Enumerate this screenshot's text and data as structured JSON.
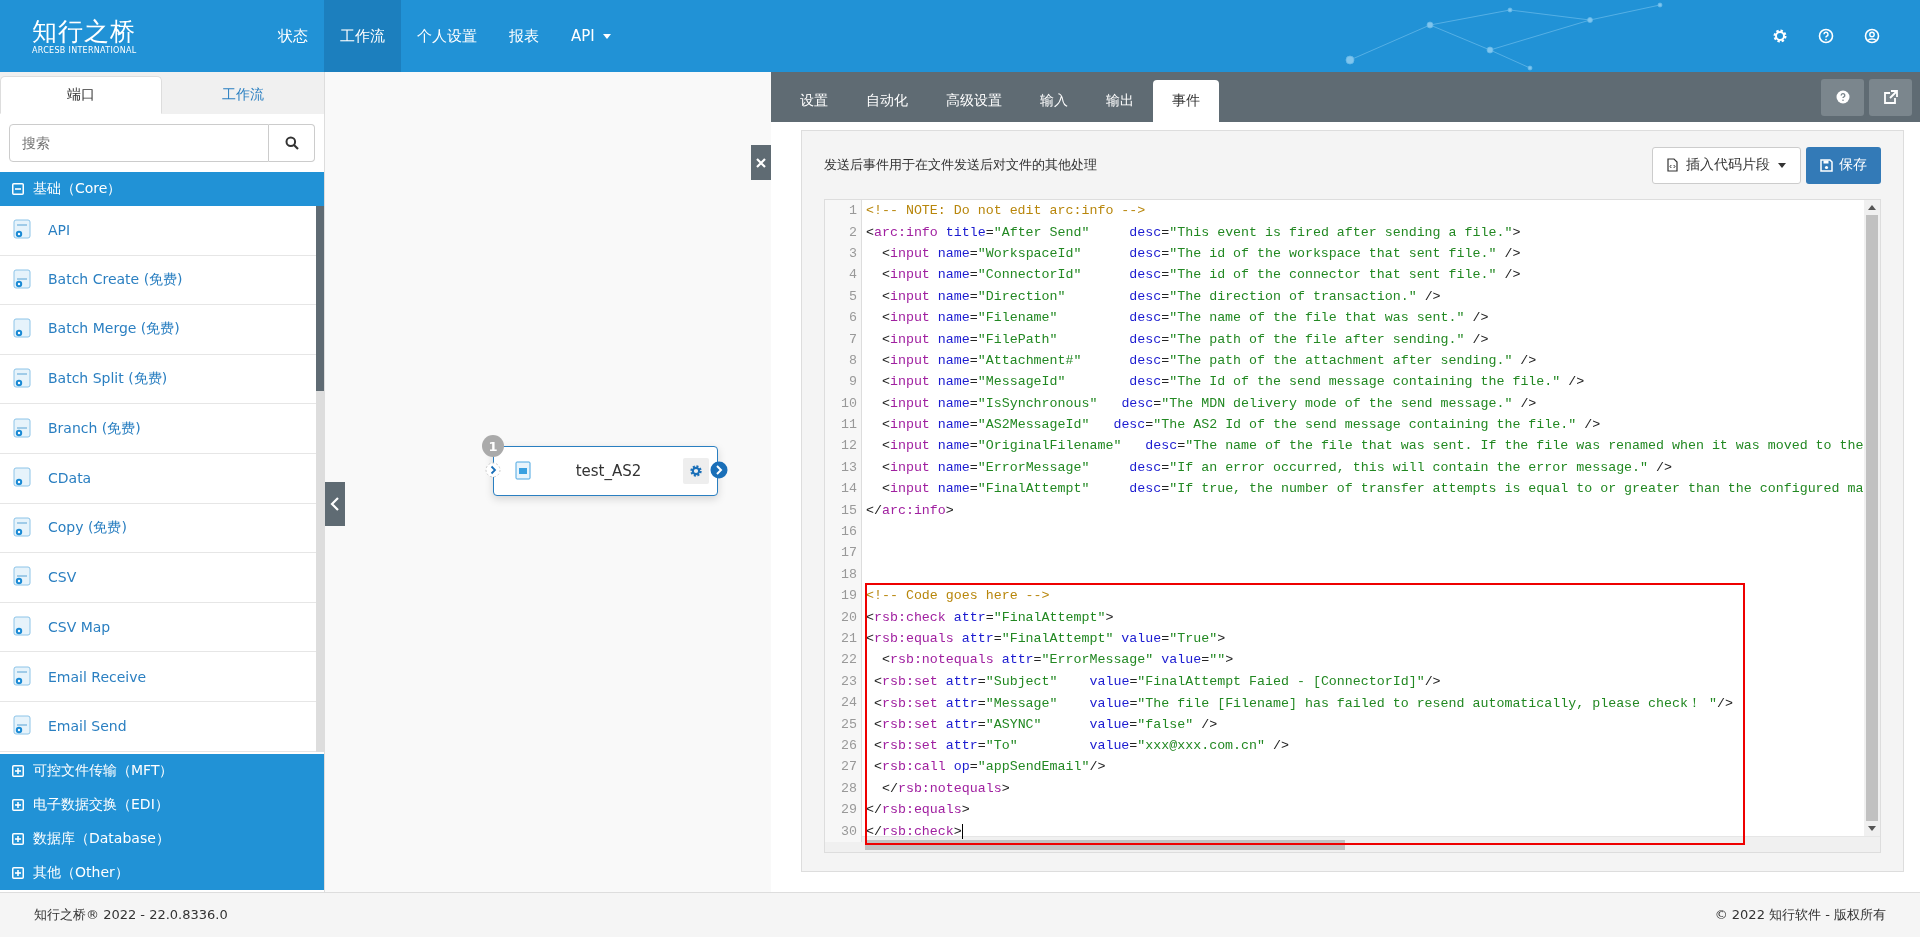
{
  "header": {
    "logo": "知行之桥",
    "logo_subtitle": "ARCESB INTERNATIONAL",
    "nav": [
      {
        "label": "状态",
        "selected": false,
        "has_menu": false
      },
      {
        "label": "工作流",
        "selected": true,
        "has_menu": false
      },
      {
        "label": "个人设置",
        "selected": false,
        "has_menu": false
      },
      {
        "label": "报表",
        "selected": false,
        "has_menu": false
      },
      {
        "label": "API",
        "selected": false,
        "has_menu": true
      }
    ]
  },
  "sidebar": {
    "tabs": [
      {
        "label": "端口",
        "selected": true
      },
      {
        "label": "工作流",
        "selected": false
      }
    ],
    "search": {
      "placeholder": "搜索"
    },
    "categories": [
      {
        "label": "基础（Core）",
        "expanded": true,
        "items": [
          "API",
          "Batch Create (免费)",
          "Batch Merge (免费)",
          "Batch Split (免费)",
          "Branch (免费)",
          "CData",
          "Copy (免费)",
          "CSV",
          "CSV Map",
          "Email Receive",
          "Email Send"
        ]
      },
      {
        "label": "可控文件传输（MFT）",
        "expanded": false
      },
      {
        "label": "电子数据交换（EDI）",
        "expanded": false
      },
      {
        "label": "数据库（Database）",
        "expanded": false
      },
      {
        "label": "其他（Other）",
        "expanded": false
      }
    ]
  },
  "canvas": {
    "node": {
      "badge": "1",
      "label": "test_AS2"
    }
  },
  "panel": {
    "tabs": [
      {
        "label": "设置",
        "selected": false
      },
      {
        "label": "自动化",
        "selected": false
      },
      {
        "label": "高级设置",
        "selected": false
      },
      {
        "label": "输入",
        "selected": false
      },
      {
        "label": "输出",
        "selected": false
      },
      {
        "label": "事件",
        "selected": true
      }
    ],
    "description": "发送后事件用于在文件发送后对文件的其他处理",
    "snippet_button": "插入代码片段",
    "save_button": "保存",
    "code_lines": [
      {
        "number": "1",
        "tokens": [
          {
            "kind": "comment",
            "text": "<!-- NOTE: Do not edit arc:info -->"
          }
        ]
      },
      {
        "number": "2",
        "tokens": [
          {
            "kind": "punct",
            "text": "<"
          },
          {
            "kind": "tag",
            "text": "arc:info"
          },
          {
            "kind": "attr",
            "text": " title"
          },
          {
            "kind": "punct",
            "text": "="
          },
          {
            "kind": "value",
            "text": "\"After Send\""
          },
          {
            "kind": "attr",
            "text": "     desc"
          },
          {
            "kind": "punct",
            "text": "="
          },
          {
            "kind": "value",
            "text": "\"This event is fired after sending a file.\""
          },
          {
            "kind": "punct",
            "text": ">"
          }
        ]
      },
      {
        "number": "3",
        "tokens": [
          {
            "kind": "punct",
            "text": "  <"
          },
          {
            "kind": "tag",
            "text": "input"
          },
          {
            "kind": "attr",
            "text": " name"
          },
          {
            "kind": "punct",
            "text": "="
          },
          {
            "kind": "value",
            "text": "\"WorkspaceId\""
          },
          {
            "kind": "attr",
            "text": "      desc"
          },
          {
            "kind": "punct",
            "text": "="
          },
          {
            "kind": "value",
            "text": "\"The id of the workspace that sent file.\""
          },
          {
            "kind": "punct",
            "text": " />"
          }
        ]
      },
      {
        "number": "4",
        "tokens": [
          {
            "kind": "punct",
            "text": "  <"
          },
          {
            "kind": "tag",
            "text": "input"
          },
          {
            "kind": "attr",
            "text": " name"
          },
          {
            "kind": "punct",
            "text": "="
          },
          {
            "kind": "value",
            "text": "\"ConnectorId\""
          },
          {
            "kind": "attr",
            "text": "      desc"
          },
          {
            "kind": "punct",
            "text": "="
          },
          {
            "kind": "value",
            "text": "\"The id of the connector that sent file.\""
          },
          {
            "kind": "punct",
            "text": " />"
          }
        ]
      },
      {
        "number": "5",
        "tokens": [
          {
            "kind": "punct",
            "text": "  <"
          },
          {
            "kind": "tag",
            "text": "input"
          },
          {
            "kind": "attr",
            "text": " name"
          },
          {
            "kind": "punct",
            "text": "="
          },
          {
            "kind": "value",
            "text": "\"Direction\""
          },
          {
            "kind": "attr",
            "text": "        desc"
          },
          {
            "kind": "punct",
            "text": "="
          },
          {
            "kind": "value",
            "text": "\"The direction of transaction.\""
          },
          {
            "kind": "punct",
            "text": " />"
          }
        ]
      },
      {
        "number": "6",
        "tokens": [
          {
            "kind": "punct",
            "text": "  <"
          },
          {
            "kind": "tag",
            "text": "input"
          },
          {
            "kind": "attr",
            "text": " name"
          },
          {
            "kind": "punct",
            "text": "="
          },
          {
            "kind": "value",
            "text": "\"Filename\""
          },
          {
            "kind": "attr",
            "text": "         desc"
          },
          {
            "kind": "punct",
            "text": "="
          },
          {
            "kind": "value",
            "text": "\"The name of the file that was sent.\""
          },
          {
            "kind": "punct",
            "text": " />"
          }
        ]
      },
      {
        "number": "7",
        "tokens": [
          {
            "kind": "punct",
            "text": "  <"
          },
          {
            "kind": "tag",
            "text": "input"
          },
          {
            "kind": "attr",
            "text": " name"
          },
          {
            "kind": "punct",
            "text": "="
          },
          {
            "kind": "value",
            "text": "\"FilePath\""
          },
          {
            "kind": "attr",
            "text": "         desc"
          },
          {
            "kind": "punct",
            "text": "="
          },
          {
            "kind": "value",
            "text": "\"The path of the file after sending.\""
          },
          {
            "kind": "punct",
            "text": " />"
          }
        ]
      },
      {
        "number": "8",
        "tokens": [
          {
            "kind": "punct",
            "text": "  <"
          },
          {
            "kind": "tag",
            "text": "input"
          },
          {
            "kind": "attr",
            "text": " name"
          },
          {
            "kind": "punct",
            "text": "="
          },
          {
            "kind": "value",
            "text": "\"Attachment#\""
          },
          {
            "kind": "attr",
            "text": "      desc"
          },
          {
            "kind": "punct",
            "text": "="
          },
          {
            "kind": "value",
            "text": "\"The path of the attachment after sending.\""
          },
          {
            "kind": "punct",
            "text": " />"
          }
        ]
      },
      {
        "number": "9",
        "tokens": [
          {
            "kind": "punct",
            "text": "  <"
          },
          {
            "kind": "tag",
            "text": "input"
          },
          {
            "kind": "attr",
            "text": " name"
          },
          {
            "kind": "punct",
            "text": "="
          },
          {
            "kind": "value",
            "text": "\"MessageId\""
          },
          {
            "kind": "attr",
            "text": "        desc"
          },
          {
            "kind": "punct",
            "text": "="
          },
          {
            "kind": "value",
            "text": "\"The Id of the send message containing the file.\""
          },
          {
            "kind": "punct",
            "text": " />"
          }
        ]
      },
      {
        "number": "10",
        "tokens": [
          {
            "kind": "punct",
            "text": "  <"
          },
          {
            "kind": "tag",
            "text": "input"
          },
          {
            "kind": "attr",
            "text": " name"
          },
          {
            "kind": "punct",
            "text": "="
          },
          {
            "kind": "value",
            "text": "\"IsSynchronous\""
          },
          {
            "kind": "attr",
            "text": "   desc"
          },
          {
            "kind": "punct",
            "text": "="
          },
          {
            "kind": "value",
            "text": "\"The MDN delivery mode of the send message.\""
          },
          {
            "kind": "punct",
            "text": " />"
          }
        ]
      },
      {
        "number": "11",
        "tokens": [
          {
            "kind": "punct",
            "text": "  <"
          },
          {
            "kind": "tag",
            "text": "input"
          },
          {
            "kind": "attr",
            "text": " name"
          },
          {
            "kind": "punct",
            "text": "="
          },
          {
            "kind": "value",
            "text": "\"AS2MessageId\""
          },
          {
            "kind": "attr",
            "text": "   desc"
          },
          {
            "kind": "punct",
            "text": "="
          },
          {
            "kind": "value",
            "text": "\"The AS2 Id of the send message containing the file.\""
          },
          {
            "kind": "punct",
            "text": " />"
          }
        ]
      },
      {
        "number": "12",
        "tokens": [
          {
            "kind": "punct",
            "text": "  <"
          },
          {
            "kind": "tag",
            "text": "input"
          },
          {
            "kind": "attr",
            "text": " name"
          },
          {
            "kind": "punct",
            "text": "="
          },
          {
            "kind": "value",
            "text": "\"OriginalFilename\""
          },
          {
            "kind": "attr",
            "text": "   desc"
          },
          {
            "kind": "punct",
            "text": "="
          },
          {
            "kind": "value",
            "text": "\"The name of the file that was sent. If the file was renamed when it was moved to the"
          }
        ]
      },
      {
        "number": "13",
        "tokens": [
          {
            "kind": "punct",
            "text": "  <"
          },
          {
            "kind": "tag",
            "text": "input"
          },
          {
            "kind": "attr",
            "text": " name"
          },
          {
            "kind": "punct",
            "text": "="
          },
          {
            "kind": "value",
            "text": "\"ErrorMessage\""
          },
          {
            "kind": "attr",
            "text": "     desc"
          },
          {
            "kind": "punct",
            "text": "="
          },
          {
            "kind": "value",
            "text": "\"If an error occurred, this will contain the error message.\""
          },
          {
            "kind": "punct",
            "text": " />"
          }
        ]
      },
      {
        "number": "14",
        "tokens": [
          {
            "kind": "punct",
            "text": "  <"
          },
          {
            "kind": "tag",
            "text": "input"
          },
          {
            "kind": "attr",
            "text": " name"
          },
          {
            "kind": "punct",
            "text": "="
          },
          {
            "kind": "value",
            "text": "\"FinalAttempt\""
          },
          {
            "kind": "attr",
            "text": "     desc"
          },
          {
            "kind": "punct",
            "text": "="
          },
          {
            "kind": "value",
            "text": "\"If true, the number of transfer attempts is equal to or greater than the configured ma"
          }
        ]
      },
      {
        "number": "15",
        "tokens": [
          {
            "kind": "punct",
            "text": "</"
          },
          {
            "kind": "tag",
            "text": "arc:info"
          },
          {
            "kind": "punct",
            "text": ">"
          }
        ]
      },
      {
        "number": "16"
      },
      {
        "number": "17"
      },
      {
        "number": "18"
      },
      {
        "number": "19",
        "tokens": [
          {
            "kind": "comment",
            "text": "<!-- Code goes here -->"
          }
        ]
      },
      {
        "number": "20",
        "tokens": [
          {
            "kind": "punct",
            "text": "<"
          },
          {
            "kind": "tag",
            "text": "rsb:check"
          },
          {
            "kind": "attr",
            "text": " attr"
          },
          {
            "kind": "punct",
            "text": "="
          },
          {
            "kind": "value",
            "text": "\"FinalAttempt\""
          },
          {
            "kind": "punct",
            "text": ">"
          }
        ]
      },
      {
        "number": "21",
        "tokens": [
          {
            "kind": "punct",
            "text": "<"
          },
          {
            "kind": "tag",
            "text": "rsb:equals"
          },
          {
            "kind": "attr",
            "text": " attr"
          },
          {
            "kind": "punct",
            "text": "="
          },
          {
            "kind": "value",
            "text": "\"FinalAttempt\""
          },
          {
            "kind": "attr",
            "text": " value"
          },
          {
            "kind": "punct",
            "text": "="
          },
          {
            "kind": "value",
            "text": "\"True\""
          },
          {
            "kind": "punct",
            "text": ">"
          }
        ]
      },
      {
        "number": "22",
        "tokens": [
          {
            "kind": "punct",
            "text": "  <"
          },
          {
            "kind": "tag",
            "text": "rsb:notequals"
          },
          {
            "kind": "attr",
            "text": " attr"
          },
          {
            "kind": "punct",
            "text": "="
          },
          {
            "kind": "value",
            "text": "\"ErrorMessage\""
          },
          {
            "kind": "attr",
            "text": " value"
          },
          {
            "kind": "punct",
            "text": "="
          },
          {
            "kind": "value",
            "text": "\"\""
          },
          {
            "kind": "punct",
            "text": ">"
          }
        ]
      },
      {
        "number": "23",
        "tokens": [
          {
            "kind": "punct",
            "text": " <"
          },
          {
            "kind": "tag",
            "text": "rsb:set"
          },
          {
            "kind": "attr",
            "text": " attr"
          },
          {
            "kind": "punct",
            "text": "="
          },
          {
            "kind": "value",
            "text": "\"Subject\""
          },
          {
            "kind": "attr",
            "text": "    value"
          },
          {
            "kind": "punct",
            "text": "="
          },
          {
            "kind": "value",
            "text": "\"FinalAttempt Faied - [ConnectorId]\""
          },
          {
            "kind": "punct",
            "text": "/>"
          }
        ]
      },
      {
        "number": "24",
        "tokens": [
          {
            "kind": "punct",
            "text": " <"
          },
          {
            "kind": "tag",
            "text": "rsb:set"
          },
          {
            "kind": "attr",
            "text": " attr"
          },
          {
            "kind": "punct",
            "text": "="
          },
          {
            "kind": "value",
            "text": "\"Message\""
          },
          {
            "kind": "attr",
            "text": "    value"
          },
          {
            "kind": "punct",
            "text": "="
          },
          {
            "kind": "value",
            "text": "\"The file [Filename] has failed to resend automatically, please check！ \""
          },
          {
            "kind": "punct",
            "text": "/>"
          }
        ]
      },
      {
        "number": "25",
        "tokens": [
          {
            "kind": "punct",
            "text": " <"
          },
          {
            "kind": "tag",
            "text": "rsb:set"
          },
          {
            "kind": "attr",
            "text": " attr"
          },
          {
            "kind": "punct",
            "text": "="
          },
          {
            "kind": "value",
            "text": "\"ASYNC\""
          },
          {
            "kind": "attr",
            "text": "      value"
          },
          {
            "kind": "punct",
            "text": "="
          },
          {
            "kind": "value",
            "text": "\"false\""
          },
          {
            "kind": "punct",
            "text": " />"
          }
        ]
      },
      {
        "number": "26",
        "tokens": [
          {
            "kind": "punct",
            "text": " <"
          },
          {
            "kind": "tag",
            "text": "rsb:set"
          },
          {
            "kind": "attr",
            "text": " attr"
          },
          {
            "kind": "punct",
            "text": "="
          },
          {
            "kind": "value",
            "text": "\"To\""
          },
          {
            "kind": "attr",
            "text": "         value"
          },
          {
            "kind": "punct",
            "text": "="
          },
          {
            "kind": "value",
            "text": "\"xxx@xxx.com.cn\""
          },
          {
            "kind": "punct",
            "text": " />"
          }
        ]
      },
      {
        "number": "27",
        "tokens": [
          {
            "kind": "punct",
            "text": " <"
          },
          {
            "kind": "tag",
            "text": "rsb:call"
          },
          {
            "kind": "attr",
            "text": " op"
          },
          {
            "kind": "punct",
            "text": "="
          },
          {
            "kind": "value",
            "text": "\"appSendEmail\""
          },
          {
            "kind": "punct",
            "text": "/>"
          }
        ]
      },
      {
        "number": "28",
        "tokens": [
          {
            "kind": "punct",
            "text": "  </"
          },
          {
            "kind": "tag",
            "text": "rsb:notequals"
          },
          {
            "kind": "punct",
            "text": ">"
          }
        ]
      },
      {
        "number": "29",
        "tokens": [
          {
            "kind": "punct",
            "text": "</"
          },
          {
            "kind": "tag",
            "text": "rsb:equals"
          },
          {
            "kind": "punct",
            "text": ">"
          }
        ]
      },
      {
        "number": "30",
        "tokens": [
          {
            "kind": "punct",
            "text": "</"
          },
          {
            "kind": "tag",
            "text": "rsb:check"
          },
          {
            "kind": "punct",
            "text": ">"
          }
        ]
      }
    ]
  },
  "footer": {
    "version": "知行之桥® 2022 - 22.0.8336.0",
    "copyright": "© 2022 知行软件 - 版权所有"
  }
}
